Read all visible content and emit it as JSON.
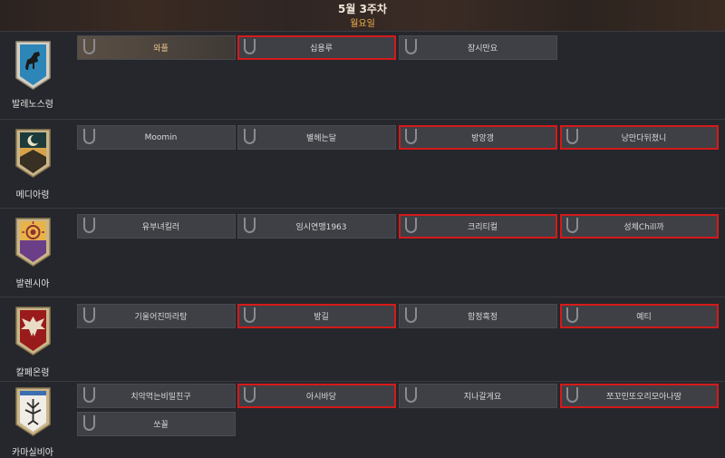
{
  "header": {
    "week": "5월 3주차",
    "day": "월요일"
  },
  "regions": [
    {
      "name": "발레노스령",
      "slots": [
        {
          "text": "와플",
          "own": true,
          "hl": false
        },
        {
          "text": "십용루",
          "hl": true
        },
        {
          "text": "잠시만요",
          "hl": false
        }
      ]
    },
    {
      "name": "메디아령",
      "slots": [
        {
          "text": "Moomin",
          "hl": false
        },
        {
          "text": "별헤는달",
          "hl": false
        },
        {
          "text": "방앙갱",
          "hl": true
        },
        {
          "text": "낭만다뒤졌니",
          "hl": true
        }
      ]
    },
    {
      "name": "발렌시아",
      "slots": [
        {
          "text": "유부녀킬러",
          "hl": false
        },
        {
          "text": "임시연맹1963",
          "hl": false
        },
        {
          "text": "크리티컬",
          "hl": true
        },
        {
          "text": "성체Chill까",
          "hl": true
        }
      ]
    },
    {
      "name": "칼페온령",
      "slots": [
        {
          "text": "기울어진마라탕",
          "hl": false
        },
        {
          "text": "방길",
          "hl": true
        },
        {
          "text": "함정흑정",
          "hl": false
        },
        {
          "text": "예티",
          "hl": true
        }
      ]
    },
    {
      "name": "카마실비아",
      "slots": [
        {
          "text": "치악먹는비밀친구",
          "hl": false
        },
        {
          "text": "아시바당",
          "hl": true
        },
        {
          "text": "지나갈게요",
          "hl": false
        },
        {
          "text": "쪼꼬민또오리모아나땅",
          "hl": true
        },
        {
          "text": "쏘꼴",
          "hl": false
        }
      ]
    }
  ],
  "colors": {
    "background": "#26272c",
    "slot": "#3f4046",
    "highlight": "#d41a1a",
    "day_accent": "#f3b24a"
  },
  "icons": [
    "horse-crest-icon",
    "crescent-moon-crest-icon",
    "sun-eye-crest-icon",
    "eagle-crest-icon",
    "tree-crest-icon",
    "guild-shield-icon"
  ]
}
